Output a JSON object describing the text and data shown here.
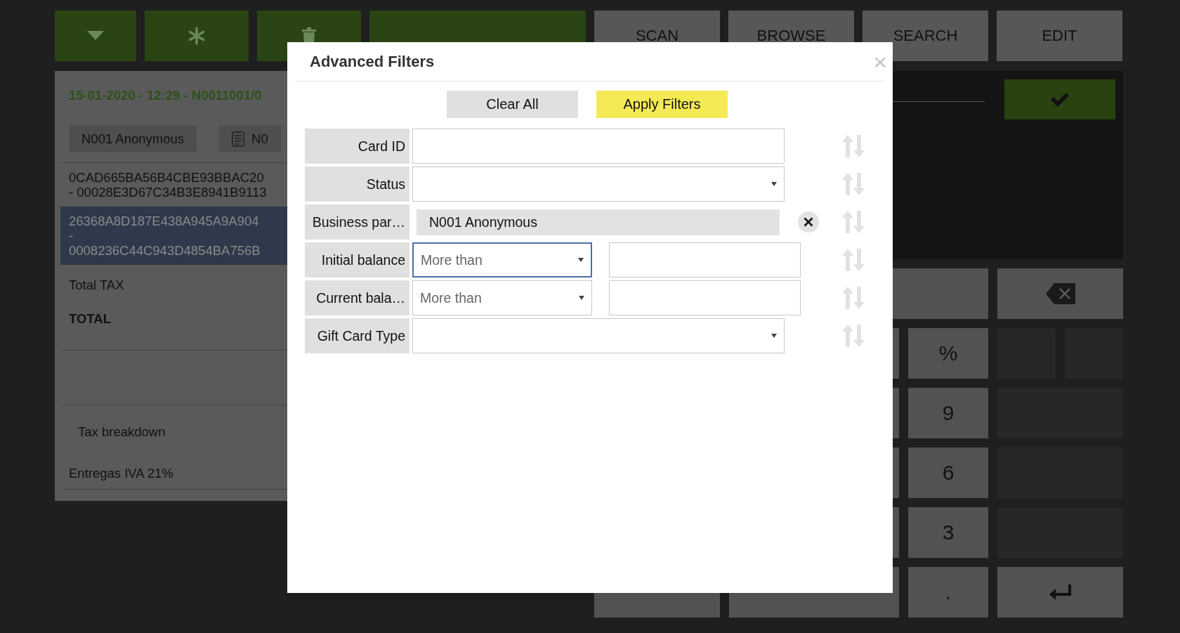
{
  "top_buttons": [
    {
      "kind": "dropdown"
    },
    {
      "kind": "asterisk"
    },
    {
      "kind": "trash"
    },
    {
      "kind": "total"
    },
    {
      "kind": "action",
      "label": "SCAN"
    },
    {
      "kind": "action",
      "label": "BROWSE"
    },
    {
      "kind": "action",
      "label": "SEARCH"
    },
    {
      "kind": "action",
      "label": "EDIT"
    }
  ],
  "receipt": {
    "header": "15-01-2020 - 12:29 - N0011001/0",
    "chips": [
      {
        "kind": "plain",
        "label": "N001 Anonymous"
      },
      {
        "kind": "document",
        "label": "N0"
      }
    ],
    "lines": [
      {
        "selected": false,
        "text": [
          "0CAD665BA56B4CBE93BBAC20",
          "- 00028E3D67C34B3E8941B9113"
        ]
      },
      {
        "selected": true,
        "text": [
          "26368A8D187E438A945A9A904",
          "-",
          "0008236C44C943D4854BA756B"
        ]
      }
    ],
    "total_tax": "Total TAX",
    "total": "TOTAL",
    "tax_breakdown": "Tax breakdown",
    "tax_line": "Entregas IVA 21%"
  },
  "keypad": [
    [
      {
        "kind": "wide"
      },
      {
        "kind": "backspace"
      }
    ],
    [
      {
        "kind": "blank"
      },
      {
        "kind": "label",
        "label": "%"
      },
      {
        "kind": "split"
      }
    ],
    [
      {
        "kind": "blank"
      },
      {
        "kind": "label",
        "label": "9"
      },
      {
        "kind": "dark"
      }
    ],
    [
      {
        "kind": "blank"
      },
      {
        "kind": "label",
        "label": "6"
      },
      {
        "kind": "dark"
      }
    ],
    [
      {
        "kind": "blank"
      },
      {
        "kind": "label",
        "label": "3"
      },
      {
        "kind": "dark"
      }
    ],
    [
      {
        "kind": "blank"
      },
      {
        "kind": "blank"
      },
      {
        "kind": "label",
        "label": "."
      },
      {
        "kind": "enter"
      }
    ]
  ],
  "dialog": {
    "title": "Advanced Filters",
    "close": "×",
    "buttons": [
      {
        "label": "Clear All",
        "primary": false
      },
      {
        "label": "Apply Filters",
        "primary": true
      }
    ],
    "filters": [
      {
        "kind": "text",
        "label": "Card ID"
      },
      {
        "kind": "select",
        "label": "Status"
      },
      {
        "kind": "chip",
        "label": "Business par…",
        "value": "N001 Anonymous"
      },
      {
        "kind": "range",
        "label": "Initial balance",
        "operator": "More than",
        "focused": true
      },
      {
        "kind": "range",
        "label": "Current bala…",
        "operator": "More than",
        "focused": false
      },
      {
        "kind": "select",
        "label": "Gift Card Type"
      }
    ]
  }
}
